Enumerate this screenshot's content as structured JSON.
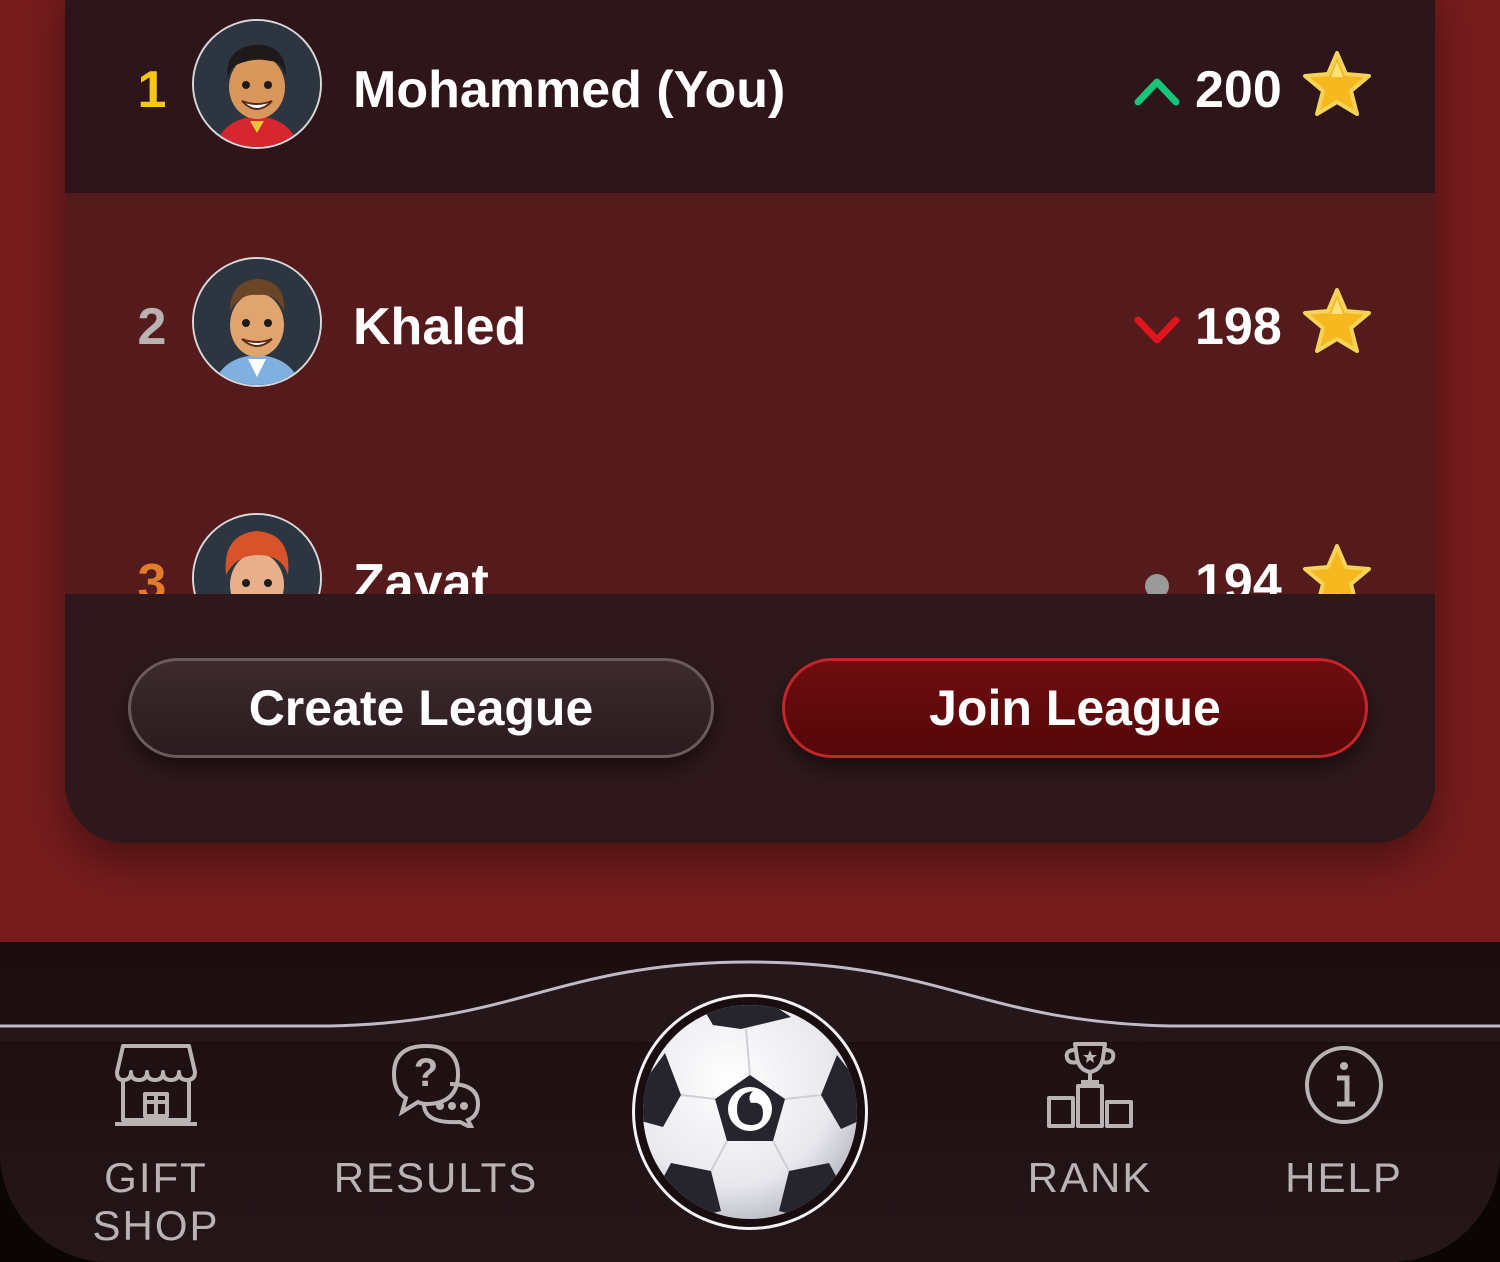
{
  "leaderboard": {
    "rows": [
      {
        "rank": "1",
        "name": "Mohammed (You)",
        "score": "200",
        "trend": "up",
        "rank_color": "#f5c518"
      },
      {
        "rank": "2",
        "name": "Khaled",
        "score": "198",
        "trend": "down",
        "rank_color": "#b8b2b3"
      },
      {
        "rank": "3",
        "name": "Zayat",
        "score": "194",
        "trend": "same",
        "rank_color": "#e27b2b"
      }
    ]
  },
  "actions": {
    "create_label": "Create League",
    "join_label": "Join League"
  },
  "nav": {
    "items": [
      {
        "label": "GIFT SHOP",
        "icon": "gift-shop-icon"
      },
      {
        "label": "RESULTS",
        "icon": "results-icon"
      },
      {
        "label": "",
        "icon": "soccer-ball-icon"
      },
      {
        "label": "RANK",
        "icon": "podium-icon"
      },
      {
        "label": "HELP",
        "icon": "info-icon"
      }
    ]
  },
  "colors": {
    "background": "#761c1d",
    "card": "#2d1619",
    "highlight_row": "#551a1c",
    "trend_up": "#18c37a",
    "trend_down": "#e0141b",
    "trend_same": "#9a9a9a",
    "join_button": "#6e0d0f",
    "nav_text": "#b9b3b4"
  }
}
